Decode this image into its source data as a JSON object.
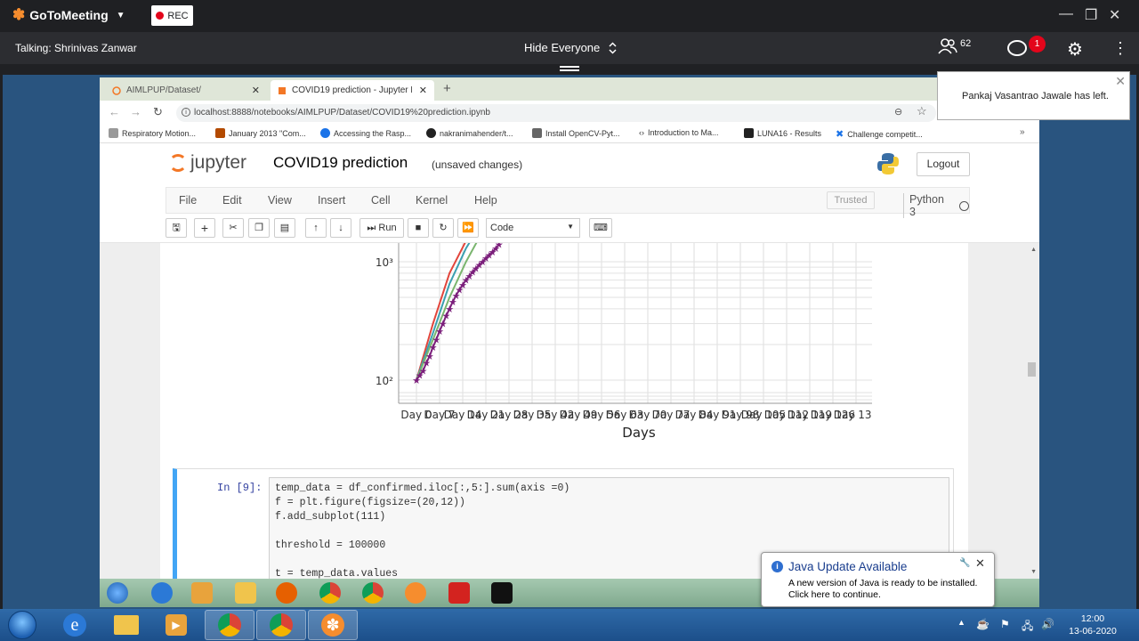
{
  "gtm": {
    "app_name": "GoToMeeting",
    "rec_label": "REC",
    "talking": "Talking: Shrinivas Zanwar",
    "hide_everyone": "Hide Everyone",
    "attendee_count": "62",
    "chat_badge": "1"
  },
  "toast": {
    "message": "Pankaj Vasantrao Jawale has left."
  },
  "browser": {
    "tabs": [
      {
        "label": "AIMLPUP/Dataset/"
      },
      {
        "label": "COVID19 prediction - Jupyter No"
      }
    ],
    "url": "localhost:8888/notebooks/AIMLPUP/Dataset/COVID19%20prediction.ipynb",
    "bookmarks": [
      {
        "label": "Respiratory Motion..."
      },
      {
        "label": "January 2013 \"Com..."
      },
      {
        "label": "Accessing the Rasp..."
      },
      {
        "label": "nakranimahender/t..."
      },
      {
        "label": "Install OpenCV-Pyt..."
      },
      {
        "label": "Introduction to Ma..."
      },
      {
        "label": "LUNA16 - Results"
      },
      {
        "label": "Challenge competit..."
      }
    ]
  },
  "jupyter": {
    "logo_text": "jupyter",
    "title": "COVID19 prediction",
    "status": "(unsaved changes)",
    "logout": "Logout",
    "menu": [
      "File",
      "Edit",
      "View",
      "Insert",
      "Cell",
      "Kernel",
      "Help"
    ],
    "trusted": "Trusted",
    "kernel_name": "Python 3",
    "run_label": "Run",
    "cell_type": "Code"
  },
  "chart_data": {
    "type": "line",
    "xlabel": "Days",
    "yscale": "log",
    "ytick_labels": [
      "10²",
      "10³"
    ],
    "ytick_values": [
      100,
      1000
    ],
    "xtick_labels": [
      "Day 0",
      "Day 7",
      "Day 14",
      "Day 21",
      "Day 28",
      "Day 35",
      "Day 42",
      "Day 49",
      "Day 56",
      "Day 63",
      "Day 70",
      "Day 77",
      "Day 84",
      "Day 91",
      "Day 98",
      "Day 105",
      "Day 112",
      "Day 119",
      "Day 126",
      "Day 133",
      "Day 140"
    ],
    "last_xtick_label": "140",
    "grid": true,
    "series": [
      {
        "color": "#7b1f7b",
        "marker": "star",
        "x": [
          0,
          1,
          2,
          3,
          4,
          5,
          6,
          7,
          8,
          9,
          10,
          11,
          12,
          13,
          14,
          15,
          16,
          17,
          18,
          19,
          20,
          21,
          22,
          23,
          24,
          25
        ],
        "y": [
          100,
          110,
          120,
          140,
          160,
          190,
          220,
          260,
          300,
          350,
          400,
          460,
          520,
          580,
          640,
          700,
          760,
          820,
          880,
          940,
          1000,
          1070,
          1140,
          1210,
          1300,
          1400
        ]
      },
      {
        "color": "#e2453c",
        "x": [
          0,
          5,
          10,
          15,
          20
        ],
        "y": [
          100,
          300,
          800,
          1500,
          2500
        ]
      },
      {
        "color": "#3a9fb0",
        "x": [
          0,
          5,
          10,
          15,
          20
        ],
        "y": [
          100,
          250,
          650,
          1300,
          2200
        ]
      },
      {
        "color": "#7ab56e",
        "x": [
          0,
          5,
          10,
          15,
          20
        ],
        "y": [
          100,
          220,
          500,
          1000,
          1800
        ]
      }
    ]
  },
  "code_cell": {
    "prompt": "In [9]:",
    "lines": [
      "temp_data = df_confirmed.iloc[:,5:].sum(axis =0)",
      "f = plt.figure(figsize=(20,12))",
      "f.add_subplot(111)",
      "",
      "threshold = 100000",
      "",
      "t = temp_data.values"
    ]
  },
  "java_popup": {
    "title": "Java Update Available",
    "line1": "A new version of Java is ready to be installed.",
    "line2": "Click here to continue."
  },
  "taskbar": {
    "time": "12:00",
    "date": "13-06-2020"
  }
}
